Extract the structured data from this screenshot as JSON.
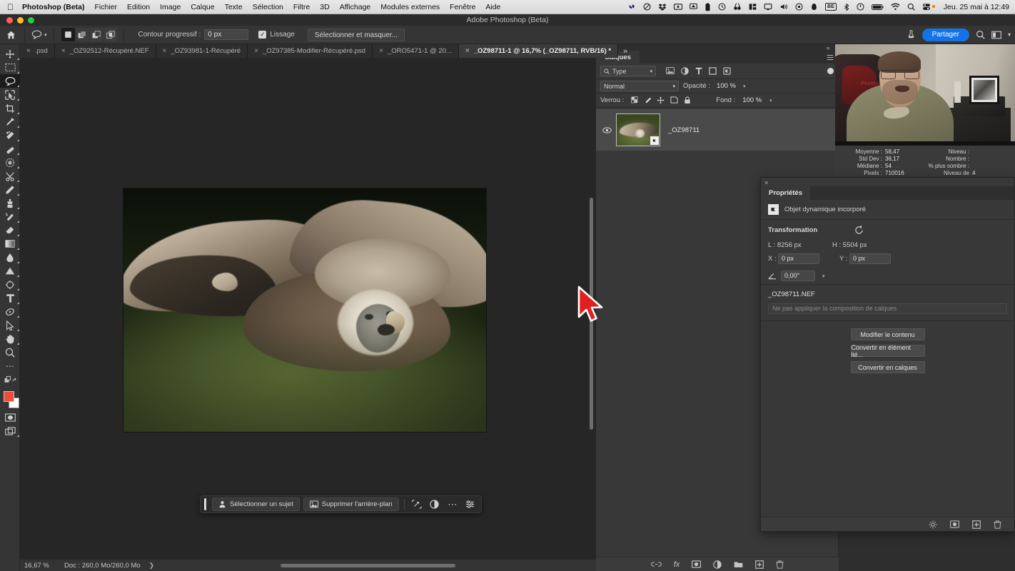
{
  "macbar": {
    "app_name": "Photoshop (Beta)",
    "apple_logo": "apple-logo",
    "menus": [
      "Fichier",
      "Edition",
      "Image",
      "Calque",
      "Texte",
      "Sélection",
      "Filtre",
      "3D",
      "Affichage",
      "Modules externes",
      "Fenêtre",
      "Aide"
    ],
    "status_icons": [
      "wacom-icon",
      "dnd-icon",
      "dropbox-icon",
      "screen-record-icon",
      "airplay-icon",
      "clipboard-icon",
      "timemachine-icon",
      "search-tool-icon",
      "stats-icon",
      "display-icon",
      "volume-icon",
      "record-icon",
      "onedrive-icon",
      "be-badge-icon",
      "bluetooth-icon",
      "power-icon",
      "battery-icon",
      "wifi-icon",
      "spotlight-icon",
      "controlcenter-icon"
    ],
    "be_badge": "BE",
    "clock": "Jeu. 25 mai à 12:49"
  },
  "titlebar": {
    "title": "Adobe Photoshop (Beta)"
  },
  "options_bar": {
    "home_icon": "home-icon",
    "tool_icon": "lasso-icon",
    "selection_modes": [
      "new-selection-icon",
      "add-selection-icon",
      "subtract-selection-icon",
      "intersect-selection-icon"
    ],
    "feather_label": "Contour progressif :",
    "feather_value": "0 px",
    "antialias_label": "Lissage",
    "antialias_checked": "✓",
    "select_mask_label": "Sélectionner et masquer...",
    "share_label": "Partager",
    "right_icons": [
      "workspace-icon",
      "search-icon",
      "arrange-icon",
      "chevron-down-icon"
    ],
    "accent_color": "#1473e6"
  },
  "toolbar": {
    "tools": [
      {
        "name": "move-tool",
        "icon": "move-icon"
      },
      {
        "name": "marquee-tool",
        "icon": "marquee-icon"
      },
      {
        "name": "lasso-tool",
        "icon": "lasso-icon",
        "active": true
      },
      {
        "name": "object-selection-tool",
        "icon": "object-selection-icon"
      },
      {
        "name": "crop-tool",
        "icon": "crop-icon"
      },
      {
        "name": "eyedropper-tool",
        "icon": "eyedropper-icon"
      },
      {
        "name": "spot-healing-tool",
        "icon": "spot-healing-icon"
      },
      {
        "name": "brush-tool",
        "icon": "brush-icon"
      },
      {
        "name": "clone-pattern-tool",
        "icon": "pattern-stamp-icon"
      },
      {
        "name": "eraser-scissors-tool",
        "icon": "scissors-icon"
      },
      {
        "name": "pencil-tool",
        "icon": "pencil-icon"
      },
      {
        "name": "clone-stamp-tool",
        "icon": "clone-stamp-icon"
      },
      {
        "name": "history-brush-tool",
        "icon": "history-brush-icon"
      },
      {
        "name": "eraser-tool",
        "icon": "eraser-icon"
      },
      {
        "name": "gradient-tool",
        "icon": "gradient-icon"
      },
      {
        "name": "blur-tool",
        "icon": "blur-drop-icon"
      },
      {
        "name": "dodge-tool",
        "icon": "dodge-triangle-icon"
      },
      {
        "name": "pen-tool",
        "icon": "pen-icon"
      },
      {
        "name": "type-tool",
        "icon": "type-icon"
      },
      {
        "name": "path-tool",
        "icon": "path-icon"
      },
      {
        "name": "direct-selection-tool",
        "icon": "arrow-pointer-icon"
      },
      {
        "name": "hand-tool",
        "icon": "hand-icon"
      },
      {
        "name": "zoom-tool",
        "icon": "magnifier-icon"
      },
      {
        "name": "more-tools",
        "icon": "ellipsis-icon"
      },
      {
        "name": "edit-toolbar",
        "icon": "toolbar-edit-icon"
      }
    ],
    "foreground_color": "#e8503a",
    "background_color": "#ffffff",
    "quickmask_icon": "quickmask-icon",
    "screenmode_icon": "screen-mode-icon"
  },
  "tabs": {
    "items": [
      {
        "label": ".psd",
        "active": false
      },
      {
        "label": "_OZ92512-Récupéré.NEF",
        "active": false
      },
      {
        "label": "_OZ93981-1-Récupéré",
        "active": false
      },
      {
        "label": "_OZ97385-Modifier-Récupéré.psd",
        "active": false
      },
      {
        "label": "_ORO5471-1 @ 20...",
        "active": false
      },
      {
        "label": "_OZ98711-1 @ 16,7% (_OZ98711, RVB/16) *",
        "active": true
      }
    ],
    "close_glyph": "×",
    "overflow_glyph": "»"
  },
  "canvas": {
    "image_description": "vulture-in-flight-photo"
  },
  "context_bar": {
    "select_subject_label": "Sélectionner un sujet",
    "select_subject_icon": "person-select-icon",
    "remove_bg_label": "Supprimer l'arrière-plan",
    "remove_bg_icon": "image-remove-bg-icon",
    "icons": [
      "transform-icon",
      "adjustment-icon",
      "ellipsis-icon",
      "settings-sliders-icon"
    ]
  },
  "statusbar": {
    "zoom": "16,67 %",
    "doc_info": "Doc : 260,0 Mo/260,0 Mo",
    "arrow_glyph": "❯"
  },
  "layers_panel": {
    "tab_label": "Calques",
    "menu_icon": "panel-menu-icon",
    "filter_label": "Type",
    "filter_search_icon": "search-icon",
    "filter_icons": [
      "pixel-filter-icon",
      "adjustment-filter-icon",
      "type-filter-icon",
      "shape-filter-icon",
      "smartobject-filter-icon"
    ],
    "filter_toggle_icon": "filter-toggle-icon",
    "blend_mode": "Normal",
    "opacity_label": "Opacité :",
    "opacity_value": "100 %",
    "lock_label": "Verrou :",
    "lock_icons": [
      "lock-transparent-icon",
      "lock-image-icon",
      "lock-position-icon",
      "lock-artboard-icon",
      "lock-all-icon"
    ],
    "fill_label": "Fond :",
    "fill_value": "100 %",
    "layers": [
      {
        "name": "_OZ98711",
        "visible": true,
        "smart_object_badge": "smart-object-icon"
      }
    ],
    "eye_icon": "eye-icon",
    "footer_icons": [
      "link-layers-icon",
      "fx-icon",
      "add-mask-icon",
      "adjustment-layer-icon",
      "new-group-icon",
      "new-layer-icon",
      "delete-layer-icon"
    ],
    "fx_label": "fx"
  },
  "histogram_panel": {
    "rows": [
      {
        "key": "Moyenne :",
        "value": "58,47",
        "key2": "Niveau :",
        "value2": ""
      },
      {
        "key": "Std Dev :",
        "value": "36,17",
        "key2": "Nombre :",
        "value2": ""
      },
      {
        "key": "Médiane :",
        "value": "54",
        "key2": "% plus sombre :",
        "value2": ""
      },
      {
        "key": "Pixels :",
        "value": "710016",
        "key2": "Niveau de cache :",
        "value2": "4"
      }
    ]
  },
  "properties_panel": {
    "close_glyph": "×",
    "tab_label": "Propriétés",
    "type_label": "Objet dynamique incorporé",
    "type_icon": "smart-object-icon",
    "transform_label": "Transformation",
    "reset_icon": "reset-icon",
    "width_label": "L :",
    "width_value": "8256 px",
    "height_label": "H :",
    "height_value": "5504 px",
    "x_label": "X :",
    "x_value": "0 px",
    "y_label": "Y :",
    "y_value": "0 px",
    "angle_icon": "angle-icon",
    "angle_value": "0,00°",
    "filename": "_OZ98711.NEF",
    "comp_placeholder": "Ne pas appliquer la composition de calques",
    "buttons": [
      "Modifier le contenu",
      "Convertir en élément lié...",
      "Convertir en calques"
    ],
    "footer_icons": [
      "reset-panel-icon",
      "mask-icon",
      "new-icon",
      "delete-icon"
    ]
  },
  "cursor": {
    "name": "mouse-pointer",
    "color": "#e02020"
  }
}
